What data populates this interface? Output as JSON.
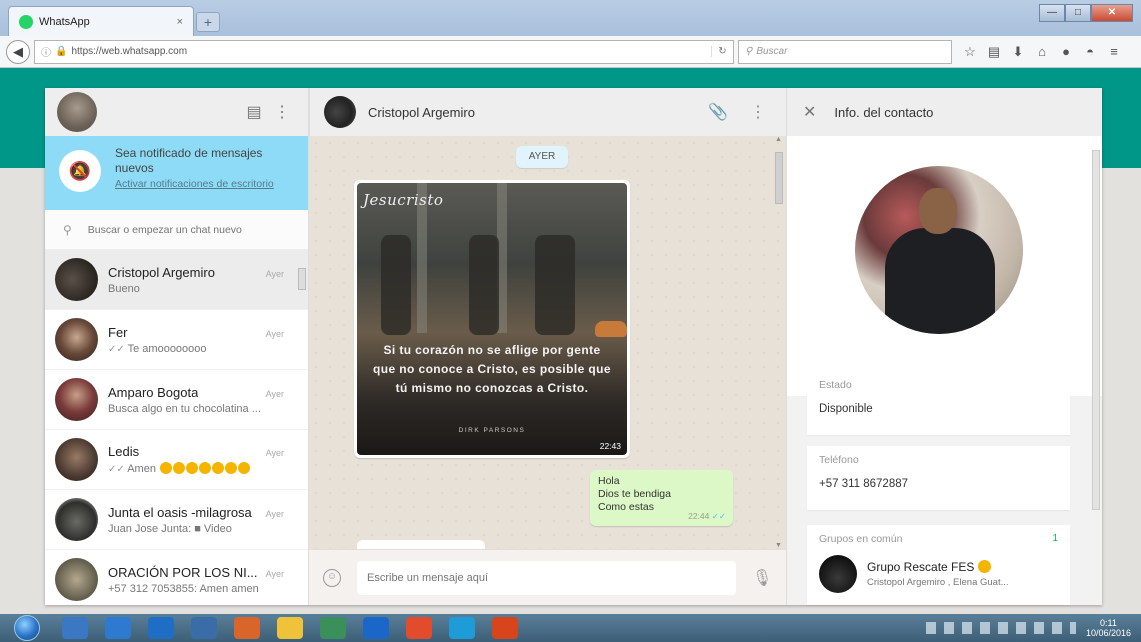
{
  "browser": {
    "tab_title": "WhatsApp",
    "tab_close": "×",
    "new_tab": "+",
    "url": "https://web.whatsapp.com",
    "search_placeholder": "Buscar",
    "window_controls": [
      "—",
      "□",
      "✕"
    ]
  },
  "sidebar": {
    "notification": {
      "title": "Sea notificado de mensajes nuevos",
      "link": "Activar notificaciones de escritorio"
    },
    "search_placeholder": "Buscar o empezar un chat nuevo",
    "chats": [
      {
        "name": "Cristopol Argemiro",
        "time": "Ayer",
        "preview": "Bueno",
        "ticks": ""
      },
      {
        "name": "Fer",
        "time": "Ayer",
        "preview": "Te amoooooooo",
        "ticks": "✓✓"
      },
      {
        "name": "Amparo Bogota",
        "time": "Ayer",
        "preview": "Busca algo en tu chocolatina ...",
        "ticks": ""
      },
      {
        "name": "Ledis",
        "time": "Ayer",
        "preview": "Amen",
        "ticks": "✓✓"
      },
      {
        "name": "Junta el oasis -milagrosa",
        "time": "Ayer",
        "preview": "Juan Jose Junta: ■ Video",
        "ticks": ""
      },
      {
        "name": "ORACIÓN POR LOS NI...",
        "time": "Ayer",
        "preview": "+57 312 7053855: Amen amen",
        "ticks": ""
      }
    ]
  },
  "conversation": {
    "contact_name": "Cristopol Argemiro",
    "day_divider": "AYER",
    "image_message": {
      "logo_text": "Jesucristo",
      "quote": "Si tu corazón no se aflige por gente que no conoce a Cristo, es posible que tú mismo no conozcas a Cristo.",
      "author": "DIRK PARSONS",
      "time": "22:43"
    },
    "text_message": {
      "lines": [
        "Hola",
        "Dios te bendiga",
        "Como estas"
      ],
      "time": "22:44",
      "ticks": "✓✓"
    },
    "composer_placeholder": "Escribe un mensaje aquí"
  },
  "contact_info": {
    "header_title": "Info. del contacto",
    "estado_label": "Estado",
    "estado_value": "Disponible",
    "phone_label": "Teléfono",
    "phone_value": "+57 311 8672887",
    "groups_label": "Grupos en común",
    "groups_count": "1",
    "group_name": "Grupo Rescate FES",
    "group_members": "Cristopol Argemiro , Elena Guat..."
  },
  "taskbar": {
    "clock_time": "0:11",
    "clock_date": "10/06/2016",
    "icon_colors": [
      "#3a78c4",
      "#2f7ad1",
      "#1f6ec6",
      "#3a6ca8",
      "#d9652b",
      "#f0c23a",
      "#3b8f5a",
      "#1a66c9",
      "#e24b2b",
      "#1e9cd8",
      "#d8441b"
    ]
  },
  "colors": {
    "teal_band": "#009688",
    "notification_bg": "#8edbf7",
    "outgoing_bubble": "#dcf8c6"
  }
}
